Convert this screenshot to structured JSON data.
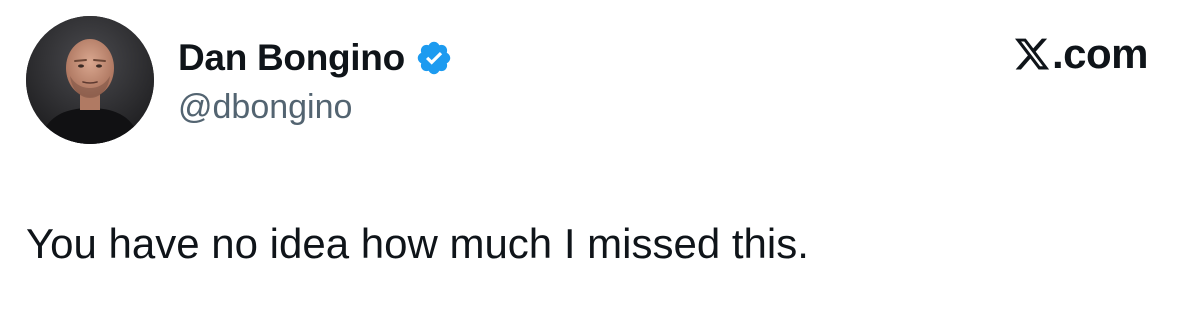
{
  "author": {
    "display_name": "Dan Bongino",
    "handle": "@dbongino",
    "verified": true,
    "verified_color": "#1d9bf0"
  },
  "brand": {
    "icon": "x-logo-icon",
    "text": ".com"
  },
  "tweet": {
    "text": "You have no idea how much I missed this."
  },
  "colors": {
    "primary_text": "#0f1419",
    "secondary_text": "#536471",
    "background": "#ffffff"
  }
}
